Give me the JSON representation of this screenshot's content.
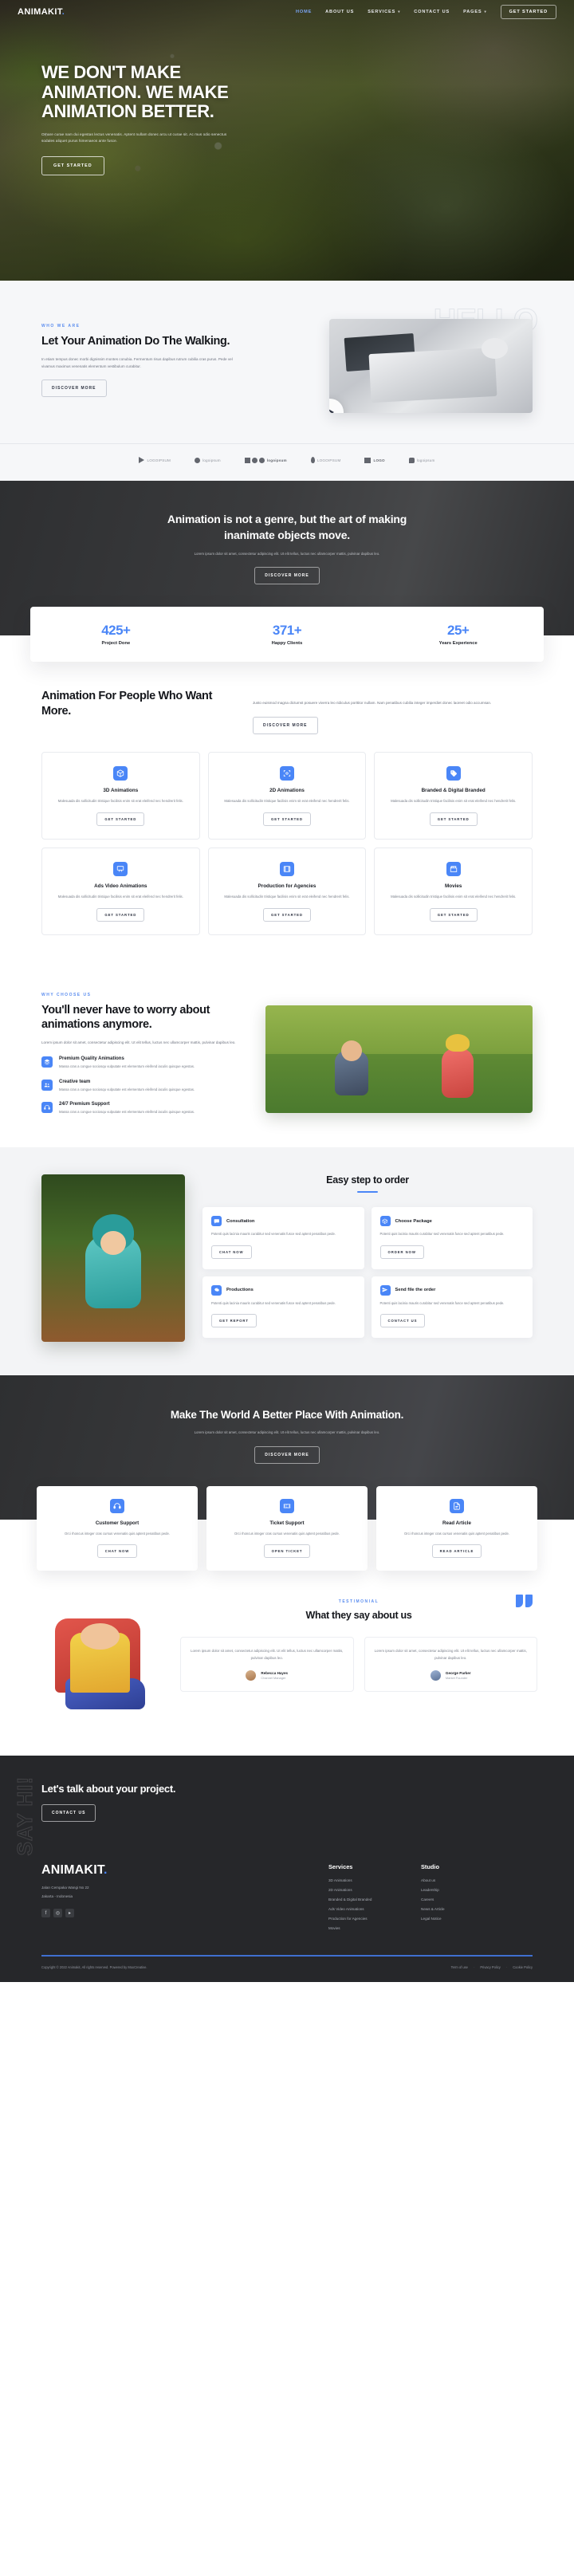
{
  "brand": {
    "name": "ANIMAKIT",
    "dot": "."
  },
  "nav": {
    "items": [
      {
        "label": "HOME",
        "caret": ""
      },
      {
        "label": "ABOUT US",
        "caret": ""
      },
      {
        "label": "SERVICES",
        "caret": "▾"
      },
      {
        "label": "CONTACT US",
        "caret": ""
      },
      {
        "label": "PAGES",
        "caret": "▾"
      }
    ],
    "cta": "GET STARTED"
  },
  "hero": {
    "title": "WE DON'T MAKE ANIMATION. WE MAKE ANIMATION BETTER.",
    "paragraph": "Ornare curae nam dui egestas lectus venenatis. Aptent nullam donec arcu ut curae sit. Ac mus odio senectus sodales aliquet purus himenaeos ante fusce.",
    "button": "GET STARTED"
  },
  "about": {
    "eyebrow": "WHO WE ARE",
    "title": "Let Your Animation Do The Walking.",
    "paragraph": "In etiam tempus donec morbi dignissim montes conubia. Fermentum risus dapibus rutrum cubilia cras purus. Pede vel vivamus maximus venenatis elementum vestibulum curabitur.",
    "button": "DISCOVER MORE",
    "ghost_word": "HELLO"
  },
  "logos": [
    {
      "label": "LOGOIPSUM",
      "mark": "triangle-logo-icon"
    },
    {
      "label": "logoipsum",
      "mark": "circle-logo-icon"
    },
    {
      "label": "logoipsum",
      "mark": "dots-logo-icon"
    },
    {
      "label": "LOGOIPSUM",
      "mark": "pin-logo-icon"
    },
    {
      "label": "LOGO",
      "mark": "square-logo-icon"
    },
    {
      "label": "logoipsum",
      "mark": "tag-logo-icon"
    }
  ],
  "quote": {
    "title": "Animation is not a genre, but the art of making inanimate objects move.",
    "paragraph": "Lorem ipsum dolor sit amet, consectetur adipiscing elit. Ut elit tellus, luctus nec ullamcorper mattis, pulvinar dapibus leo.",
    "button": "DISCOVER MORE"
  },
  "stats": [
    {
      "number": "425+",
      "label": "Project Done"
    },
    {
      "number": "371+",
      "label": "Happy Clients"
    },
    {
      "number": "25+",
      "label": "Years Experience"
    }
  ],
  "services": {
    "title": "Animation For People Who Want More.",
    "paragraph": "Justo euismod magna dictumst posuere viverra leo ridiculus porttitor nullam. Nam penatibus cubilia integer imperdiet donec laoreet odio accumsan.",
    "button": "DISCOVER MORE",
    "cards": [
      {
        "title": "3D Animations",
        "desc": "Malesuada dis sollicitudin tristique facilisis enim sit erat eleifend nec hendrerit felis.",
        "button": "GET STARTED",
        "icon": "cube-icon"
      },
      {
        "title": "2D Animations",
        "desc": "Malesuada dis sollicitudin tristique facilisis enim sit erat eleifend nec hendrerit felis.",
        "button": "GET STARTED",
        "icon": "focus-icon"
      },
      {
        "title": "Branded & Digital Branded",
        "desc": "Malesuada dis sollicitudin tristique facilisis enim sit erat eleifend nec hendrerit felis.",
        "button": "GET STARTED",
        "icon": "tag-icon"
      },
      {
        "title": "Ads Video Animations",
        "desc": "Malesuada dis sollicitudin tristique facilisis enim sit erat eleifend nec hendrerit felis.",
        "button": "GET STARTED",
        "icon": "billboard-icon"
      },
      {
        "title": "Production for Agencies",
        "desc": "Malesuada dis sollicitudin tristique facilisis enim sit erat eleifend nec hendrerit felis.",
        "button": "GET STARTED",
        "icon": "film-icon"
      },
      {
        "title": "Movies",
        "desc": "Malesuada dis sollicitudin tristique facilisis enim sit erat eleifend nec hendrerit felis.",
        "button": "GET STARTED",
        "icon": "clapperboard-icon"
      }
    ]
  },
  "why": {
    "eyebrow": "WHY CHOOSE US",
    "title": "You'll never have to worry about animations anymore.",
    "paragraph": "Lorem ipsum dolor sit amet, consectetur adipiscing elit. Ut elit tellus, luctus nec ullamcorper mattis, pulvinar dapibus leo.",
    "features": [
      {
        "title": "Premium Quality Animations",
        "desc": "Massa cras a congue sociosqu vulputate est elementum eleifend iaculis quisque egestas.",
        "icon": "layers-icon"
      },
      {
        "title": "Creative team",
        "desc": "Massa cras a congue sociosqu vulputate est elementum eleifend iaculis quisque egestas.",
        "icon": "team-icon"
      },
      {
        "title": "24/7 Premium Support",
        "desc": "Massa cras a congue sociosqu vulputate est elementum eleifend iaculis quisque egestas.",
        "icon": "headset-icon"
      }
    ]
  },
  "steps": {
    "title": "Easy step to order",
    "cards": [
      {
        "title": "Consultation",
        "desc": "Potenti quis lacinia mauris curabitur sed venenatis fusce sed aptent penatibus pede.",
        "button": "CHAT NOW",
        "icon": "chat-icon"
      },
      {
        "title": "Choose Package",
        "desc": "Potenti quis lacinia mauris curabitur sed venenatis fusce sed aptent penatibus pede.",
        "button": "ORDER NOW",
        "icon": "package-icon"
      },
      {
        "title": "Productions",
        "desc": "Potenti quis lacinia mauris curabitur sed venenatis fusce sed aptent penatibus pede.",
        "button": "GET REPORT",
        "icon": "gear-icon"
      },
      {
        "title": "Send file the order",
        "desc": "Potenti quis lacinia mauris curabitur sed venenatis fusce sed aptent penatibus pede.",
        "button": "CONTACT US",
        "icon": "send-icon"
      }
    ]
  },
  "better": {
    "title": "Make The World A Better Place With Animation.",
    "paragraph": "Lorem ipsum dolor sit amet, consectetur adipiscing elit. Ut elit tellus, luctus nec ullamcorper mattis, pulvinar dapibus leo.",
    "button": "DISCOVER MORE",
    "cards": [
      {
        "title": "Customer Support",
        "desc": "Orci rhoncus integer cras cursus venenatis quis aptent penatibus pede.",
        "button": "CHAT NOW",
        "icon": "headset-icon"
      },
      {
        "title": "Ticket Support",
        "desc": "Orci rhoncus integer cras cursus venenatis quis aptent penatibus pede.",
        "button": "OPEN TICKET",
        "icon": "ticket-icon"
      },
      {
        "title": "Read Article",
        "desc": "Orci rhoncus integer cras cursus venenatis quis aptent penatibus pede.",
        "button": "READ ARTICLE",
        "icon": "document-icon"
      }
    ]
  },
  "testimonial": {
    "eyebrow": "TESTIMONIAL",
    "title": "What they say about us",
    "items": [
      {
        "text": "Lorem ipsum dolor sit amet, consectetur adipiscing elit. Ut elit tellus, luctus nec ullamcorper mattis, pulvinar dapibus leo.",
        "name": "Rebecca Hayes",
        "role": "Channel Manager"
      },
      {
        "text": "Lorem ipsum dolor sit amet, consectetur adipiscing elit. Ut elit tellus, luctus nec ullamcorper mattis, pulvinar dapibus leo.",
        "name": "George Parker",
        "role": "Market Founder"
      }
    ]
  },
  "footer": {
    "watermark": "SAY HI!",
    "cta_title": "Let's talk about your project.",
    "cta_button": "CONTACT US",
    "address_line1": "Jalan Cempaka Wangi No 22",
    "address_line2": "Jakarta - Indonesia",
    "socials": [
      {
        "name": "facebook-icon",
        "glyph": "f"
      },
      {
        "name": "instagram-icon",
        "glyph": "◎"
      },
      {
        "name": "youtube-icon",
        "glyph": "▸"
      }
    ],
    "columns": [
      {
        "title": "Services",
        "links": [
          "3D Animations",
          "2D Animations",
          "Branded & Digital Branded",
          "Ads Video Animations",
          "Production for Agencies",
          "Movies"
        ]
      },
      {
        "title": "Studio",
        "links": [
          "About us",
          "Leadership",
          "Careers",
          "News & Article",
          "Legal Notice"
        ]
      }
    ],
    "copyright": "Copyright © 2022 Animakit, All rights reserved. Powered by MoxCreative.",
    "legal": [
      "Term of use",
      "Privacy Policy",
      "Cookie Policy"
    ],
    "legal_sep": "·"
  },
  "colors": {
    "accent": "#4a86f7",
    "dark": "#26272a",
    "light_bg": "#f6f7f9"
  }
}
